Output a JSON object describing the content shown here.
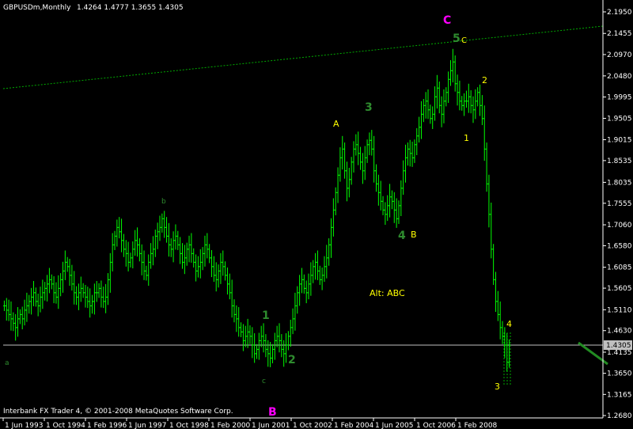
{
  "header": {
    "symbol_info": "GBPUSDm,Monthly",
    "ohlc": "1.4264 1.4777 1.3655 1.4305"
  },
  "footer": {
    "copyright": "Interbank FX Trader 4, © 2001-2008 MetaQuotes Software Corp."
  },
  "colors": {
    "background": "#000000",
    "axis": "#ffffff",
    "bars": "#00ff00",
    "trendline": "#00aa00",
    "current_price_line": "#c0c0c0",
    "wave_yellow": "#ffff00",
    "wave_green": "#2e8b2e",
    "wave_magenta": "#ff00ff",
    "wave_small_green": "#4caf50"
  },
  "price_axis": {
    "ticks": [
      "2.1950",
      "2.1455",
      "2.0970",
      "2.0480",
      "1.9995",
      "1.9505",
      "1.9015",
      "1.8535",
      "1.8035",
      "1.7555",
      "1.7060",
      "1.6580",
      "1.6085",
      "1.5605",
      "1.5110",
      "1.4630",
      "1.4135",
      "1.3650",
      "1.3165",
      "1.2680"
    ],
    "current_price": "1.4305"
  },
  "time_axis": {
    "ticks": [
      "1 Jun 1993",
      "1 Oct 1994",
      "1 Feb 1996",
      "1 Jun 1997",
      "1 Oct 1998",
      "1 Feb 2000",
      "1 Jun 2001",
      "1 Oct 2002",
      "1 Feb 2004",
      "1 Jun 2005",
      "1 Oct 2006",
      "1 Feb 2008"
    ]
  },
  "chart_data": {
    "type": "ohlc",
    "ylim": [
      1.268,
      2.195
    ],
    "x_start": "1993-06",
    "x_end": "2008-12",
    "series_close": [
      1.52,
      1.51,
      1.5,
      1.49,
      1.48,
      1.47,
      1.49,
      1.5,
      1.49,
      1.51,
      1.52,
      1.53,
      1.54,
      1.55,
      1.53,
      1.52,
      1.54,
      1.55,
      1.56,
      1.57,
      1.58,
      1.57,
      1.55,
      1.54,
      1.56,
      1.58,
      1.6,
      1.62,
      1.61,
      1.59,
      1.57,
      1.55,
      1.54,
      1.55,
      1.56,
      1.55,
      1.54,
      1.53,
      1.52,
      1.53,
      1.55,
      1.55,
      1.56,
      1.54,
      1.53,
      1.54,
      1.58,
      1.62,
      1.66,
      1.68,
      1.7,
      1.69,
      1.67,
      1.65,
      1.64,
      1.62,
      1.63,
      1.65,
      1.67,
      1.66,
      1.64,
      1.62,
      1.6,
      1.59,
      1.62,
      1.64,
      1.65,
      1.68,
      1.69,
      1.7,
      1.72,
      1.7,
      1.68,
      1.66,
      1.65,
      1.67,
      1.68,
      1.66,
      1.64,
      1.62,
      1.63,
      1.65,
      1.66,
      1.64,
      1.62,
      1.6,
      1.61,
      1.62,
      1.64,
      1.66,
      1.65,
      1.63,
      1.61,
      1.59,
      1.58,
      1.6,
      1.62,
      1.61,
      1.59,
      1.57,
      1.55,
      1.52,
      1.5,
      1.49,
      1.47,
      1.46,
      1.44,
      1.45,
      1.46,
      1.45,
      1.43,
      1.41,
      1.42,
      1.44,
      1.45,
      1.44,
      1.42,
      1.41,
      1.4,
      1.42,
      1.44,
      1.45,
      1.44,
      1.42,
      1.41,
      1.43,
      1.45,
      1.47,
      1.49,
      1.52,
      1.55,
      1.57,
      1.58,
      1.56,
      1.55,
      1.57,
      1.59,
      1.61,
      1.62,
      1.6,
      1.58,
      1.59,
      1.61,
      1.63,
      1.66,
      1.7,
      1.74,
      1.78,
      1.82,
      1.86,
      1.88,
      1.83,
      1.79,
      1.81,
      1.85,
      1.88,
      1.89,
      1.87,
      1.85,
      1.83,
      1.86,
      1.89,
      1.9,
      1.88,
      1.83,
      1.8,
      1.78,
      1.76,
      1.74,
      1.73,
      1.75,
      1.77,
      1.76,
      1.74,
      1.72,
      1.75,
      1.79,
      1.83,
      1.86,
      1.88,
      1.87,
      1.86,
      1.89,
      1.91,
      1.93,
      1.96,
      1.98,
      1.99,
      1.97,
      1.95,
      1.96,
      2.0,
      2.02,
      1.98,
      1.96,
      1.99,
      2.01,
      2.04,
      2.06,
      2.08,
      2.03,
      2.01,
      1.99,
      1.98,
      1.99,
      1.99,
      2.0,
      1.98,
      1.97,
      1.99,
      2.01,
      1.98,
      1.95,
      1.88,
      1.8,
      1.73,
      1.65,
      1.58,
      1.53,
      1.5,
      1.47,
      1.45,
      1.43,
      1.39,
      1.4305
    ]
  },
  "annotations": {
    "C_main": "C",
    "five": "5",
    "c_small": "C",
    "two_top": "2",
    "one_mid": "1",
    "A_upper": "A",
    "three_green": "3",
    "four_green": "4",
    "B_upper": "B",
    "alt": "Alt: ABC",
    "b_small": "b",
    "a_small": "a",
    "c_lower": "c",
    "one_low": "1",
    "two_low": "2",
    "B_main": "B",
    "four_right": "4",
    "three_bottom": "3"
  }
}
